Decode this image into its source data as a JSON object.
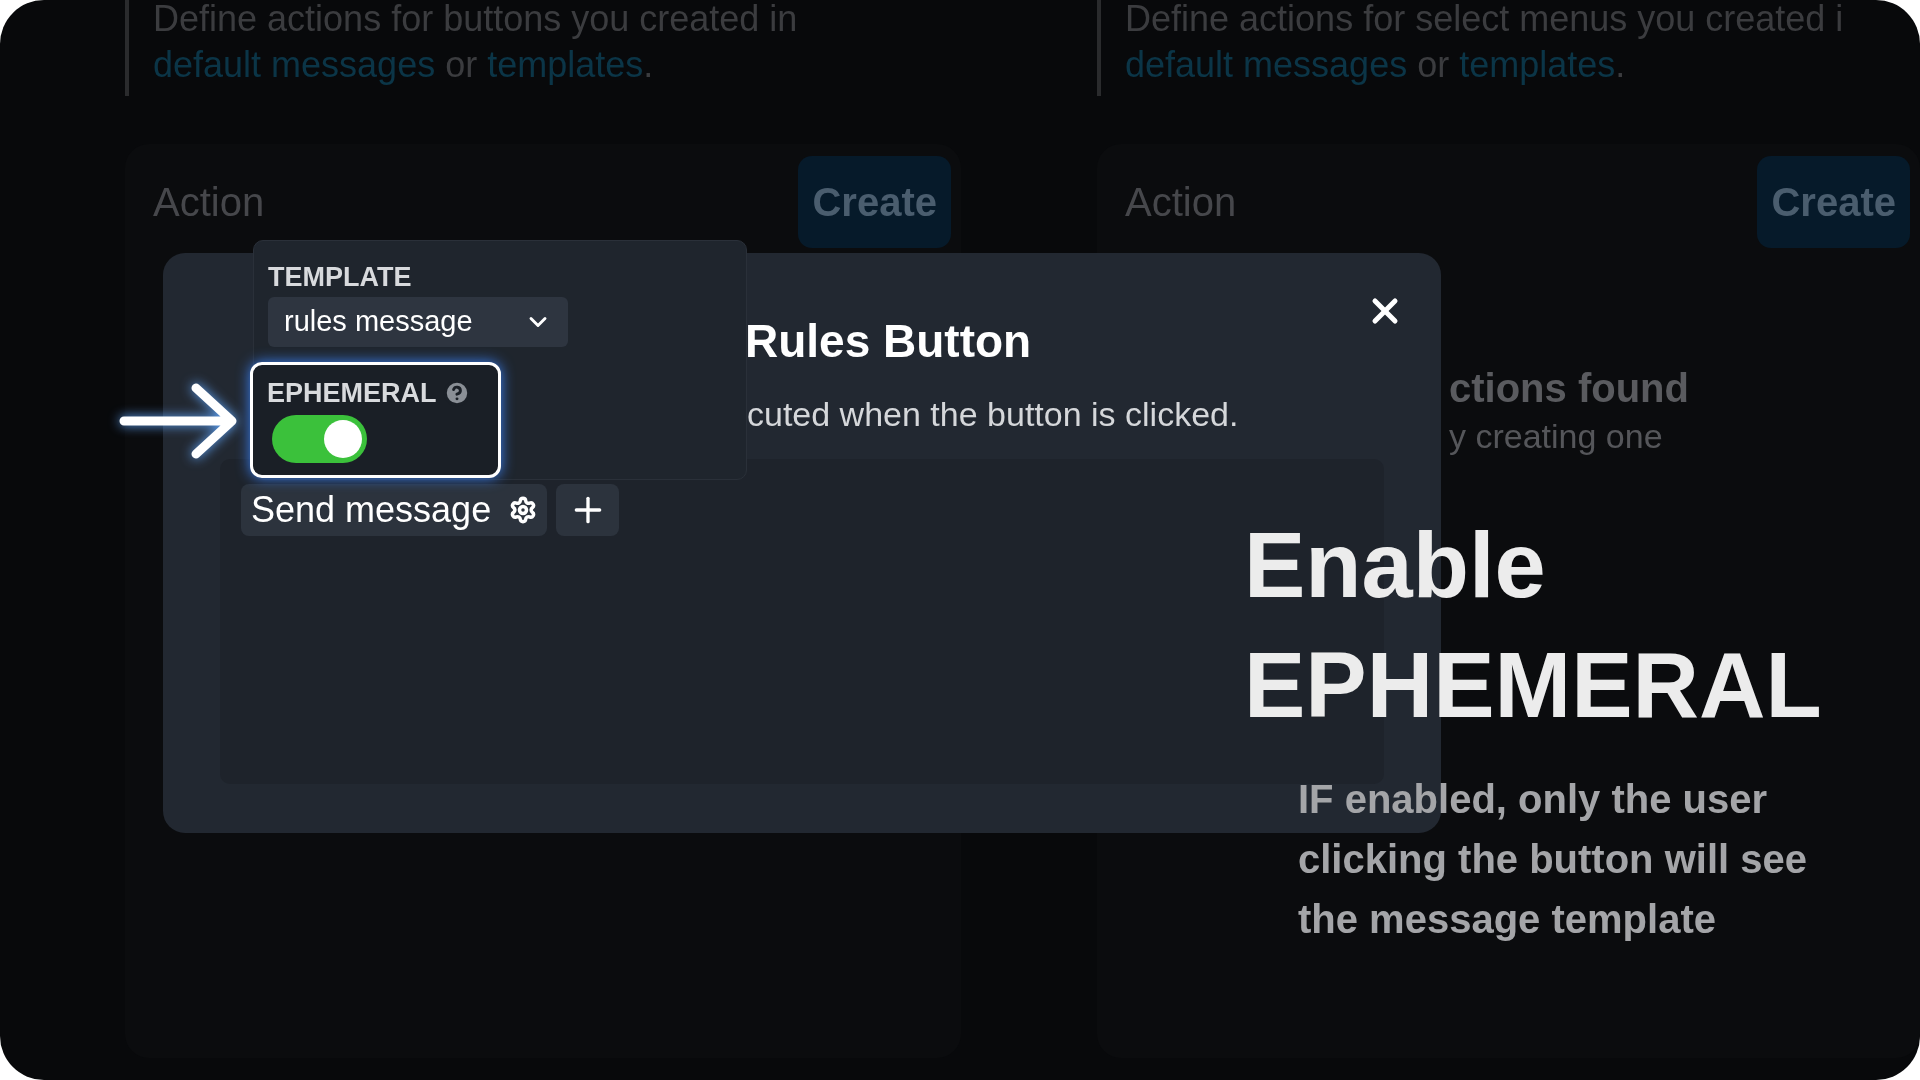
{
  "background_columns": [
    {
      "description": {
        "text": "Define actions for buttons you created in",
        "link_1": "default messages",
        "between": "or",
        "link_2": "templates",
        "end": "."
      },
      "heading": "Action",
      "button": "Create"
    },
    {
      "description": {
        "text": "Define actions for select menus you created i",
        "link_1": "default messages",
        "between": "or",
        "link_2": "templates",
        "end": "."
      },
      "heading": "Action",
      "button": "Create",
      "empty_title": "ctions found",
      "empty_hint": "y creating one"
    }
  ],
  "modal": {
    "title": "Rules Button",
    "description": "cuted when the button is clicked.",
    "actions": [
      {
        "label": "Send message"
      }
    ]
  },
  "popover": {
    "template_label": "TEMPLATE",
    "template_value": "rules message",
    "ephemeral_label": "EPHEMERAL",
    "ephemeral_on": true
  },
  "annotation": {
    "title_line_1": "Enable",
    "title_line_2": "EPHEMERAL",
    "text": "IF enabled, only the user clicking the button will see the message template"
  }
}
